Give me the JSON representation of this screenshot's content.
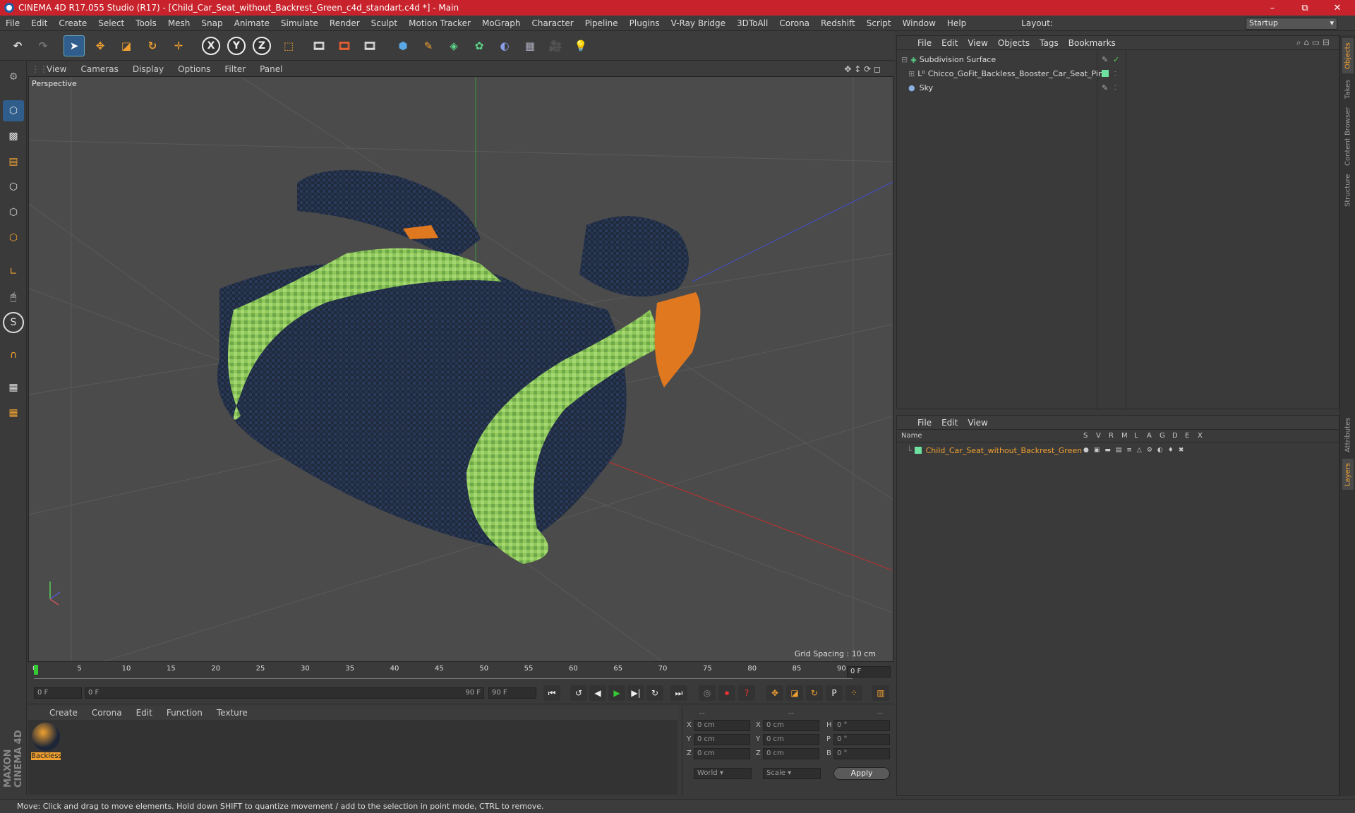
{
  "window": {
    "title": "CINEMA 4D R17.055 Studio (R17) - [Child_Car_Seat_without_Backrest_Green_c4d_standart.c4d *] - Main",
    "minimize": "–",
    "maximize": "⧉",
    "close": "✕"
  },
  "menubar": {
    "items": [
      "File",
      "Edit",
      "Create",
      "Select",
      "Tools",
      "Mesh",
      "Snap",
      "Animate",
      "Simulate",
      "Render",
      "Sculpt",
      "Motion Tracker",
      "MoGraph",
      "Character",
      "Pipeline",
      "Plugins",
      "V-Ray Bridge",
      "3DToAll",
      "Corona",
      "Redshift",
      "Script",
      "Window",
      "Help"
    ],
    "layout_label": "Layout:",
    "layout_value": "Startup"
  },
  "toolbar": {
    "axis_x": "X",
    "axis_y": "Y",
    "axis_z": "Z",
    "icons": [
      "undo-icon",
      "redo-icon",
      "select-icon",
      "move-icon",
      "scale-icon",
      "rotate-icon",
      "live-select-icon",
      "x-axis-icon",
      "y-axis-icon",
      "z-axis-icon",
      "coord-system-icon",
      "render-view-icon",
      "render-picture-viewer-icon",
      "render-settings-icon",
      "cube-icon",
      "pen-icon",
      "subdivision-icon",
      "mograph-cloner-icon",
      "deformer-icon",
      "floor-icon",
      "camera-icon",
      "light-icon"
    ]
  },
  "viewport": {
    "menu": [
      "View",
      "Cameras",
      "Display",
      "Options",
      "Filter",
      "Panel"
    ],
    "label": "Perspective",
    "grid_spacing": "Grid Spacing : 10 cm"
  },
  "timeline": {
    "ticks": [
      "0",
      "5",
      "10",
      "15",
      "20",
      "25",
      "30",
      "35",
      "40",
      "45",
      "50",
      "55",
      "60",
      "65",
      "70",
      "75",
      "80",
      "85",
      "90"
    ],
    "current_frame": "0 F",
    "start_field": "0 F",
    "range_start": "0 F",
    "range_end": "90 F",
    "end_field": "90 F"
  },
  "material_manager": {
    "menu": [
      "Create",
      "Corona",
      "Edit",
      "Function",
      "Texture"
    ],
    "material_name": "Backless"
  },
  "coordinates": {
    "header": [
      "--",
      "--",
      "--"
    ],
    "rows": [
      {
        "axis1": "X",
        "v1": "0 cm",
        "axis2": "X",
        "v2": "0 cm",
        "axis3": "H",
        "v3": "0 °"
      },
      {
        "axis1": "Y",
        "v1": "0 cm",
        "axis2": "Y",
        "v2": "0 cm",
        "axis3": "P",
        "v3": "0 °"
      },
      {
        "axis1": "Z",
        "v1": "0 cm",
        "axis2": "Z",
        "v2": "0 cm",
        "axis3": "B",
        "v3": "0 °"
      }
    ],
    "mode": "World",
    "scale_mode": "Scale",
    "apply": "Apply"
  },
  "objects": {
    "menu": [
      "File",
      "Edit",
      "View",
      "Objects",
      "Tags",
      "Bookmarks"
    ],
    "items": [
      {
        "name": "Subdivision Surface",
        "color": "#cfd4d8"
      },
      {
        "name": "Chicco_GoFit_Backless_Booster_Car_Seat_Pink",
        "color": "#cfd4d8"
      },
      {
        "name": "Sky",
        "color": "#cfd4d8"
      }
    ]
  },
  "layers": {
    "menu": [
      "File",
      "Edit",
      "View"
    ],
    "columns": [
      "Name",
      "S",
      "V",
      "R",
      "M",
      "L",
      "A",
      "G",
      "D",
      "E",
      "X"
    ],
    "rows": [
      {
        "name": "Child_Car_Seat_without_Backrest_Green",
        "color": "#e8a93a"
      }
    ]
  },
  "right_tabs": [
    "Objects",
    "Takes",
    "Content Browser",
    "Structure",
    "Attributes",
    "Layers"
  ],
  "status": "Move: Click and drag to move elements. Hold down SHIFT to quantize movement / add to the selection in point mode, CTRL to remove.",
  "brand": "MAXON CINEMA 4D",
  "colors": {
    "accent": "#2f5d8c",
    "title_bar": "#c8232c",
    "highlight_orange": "#f0a030"
  }
}
